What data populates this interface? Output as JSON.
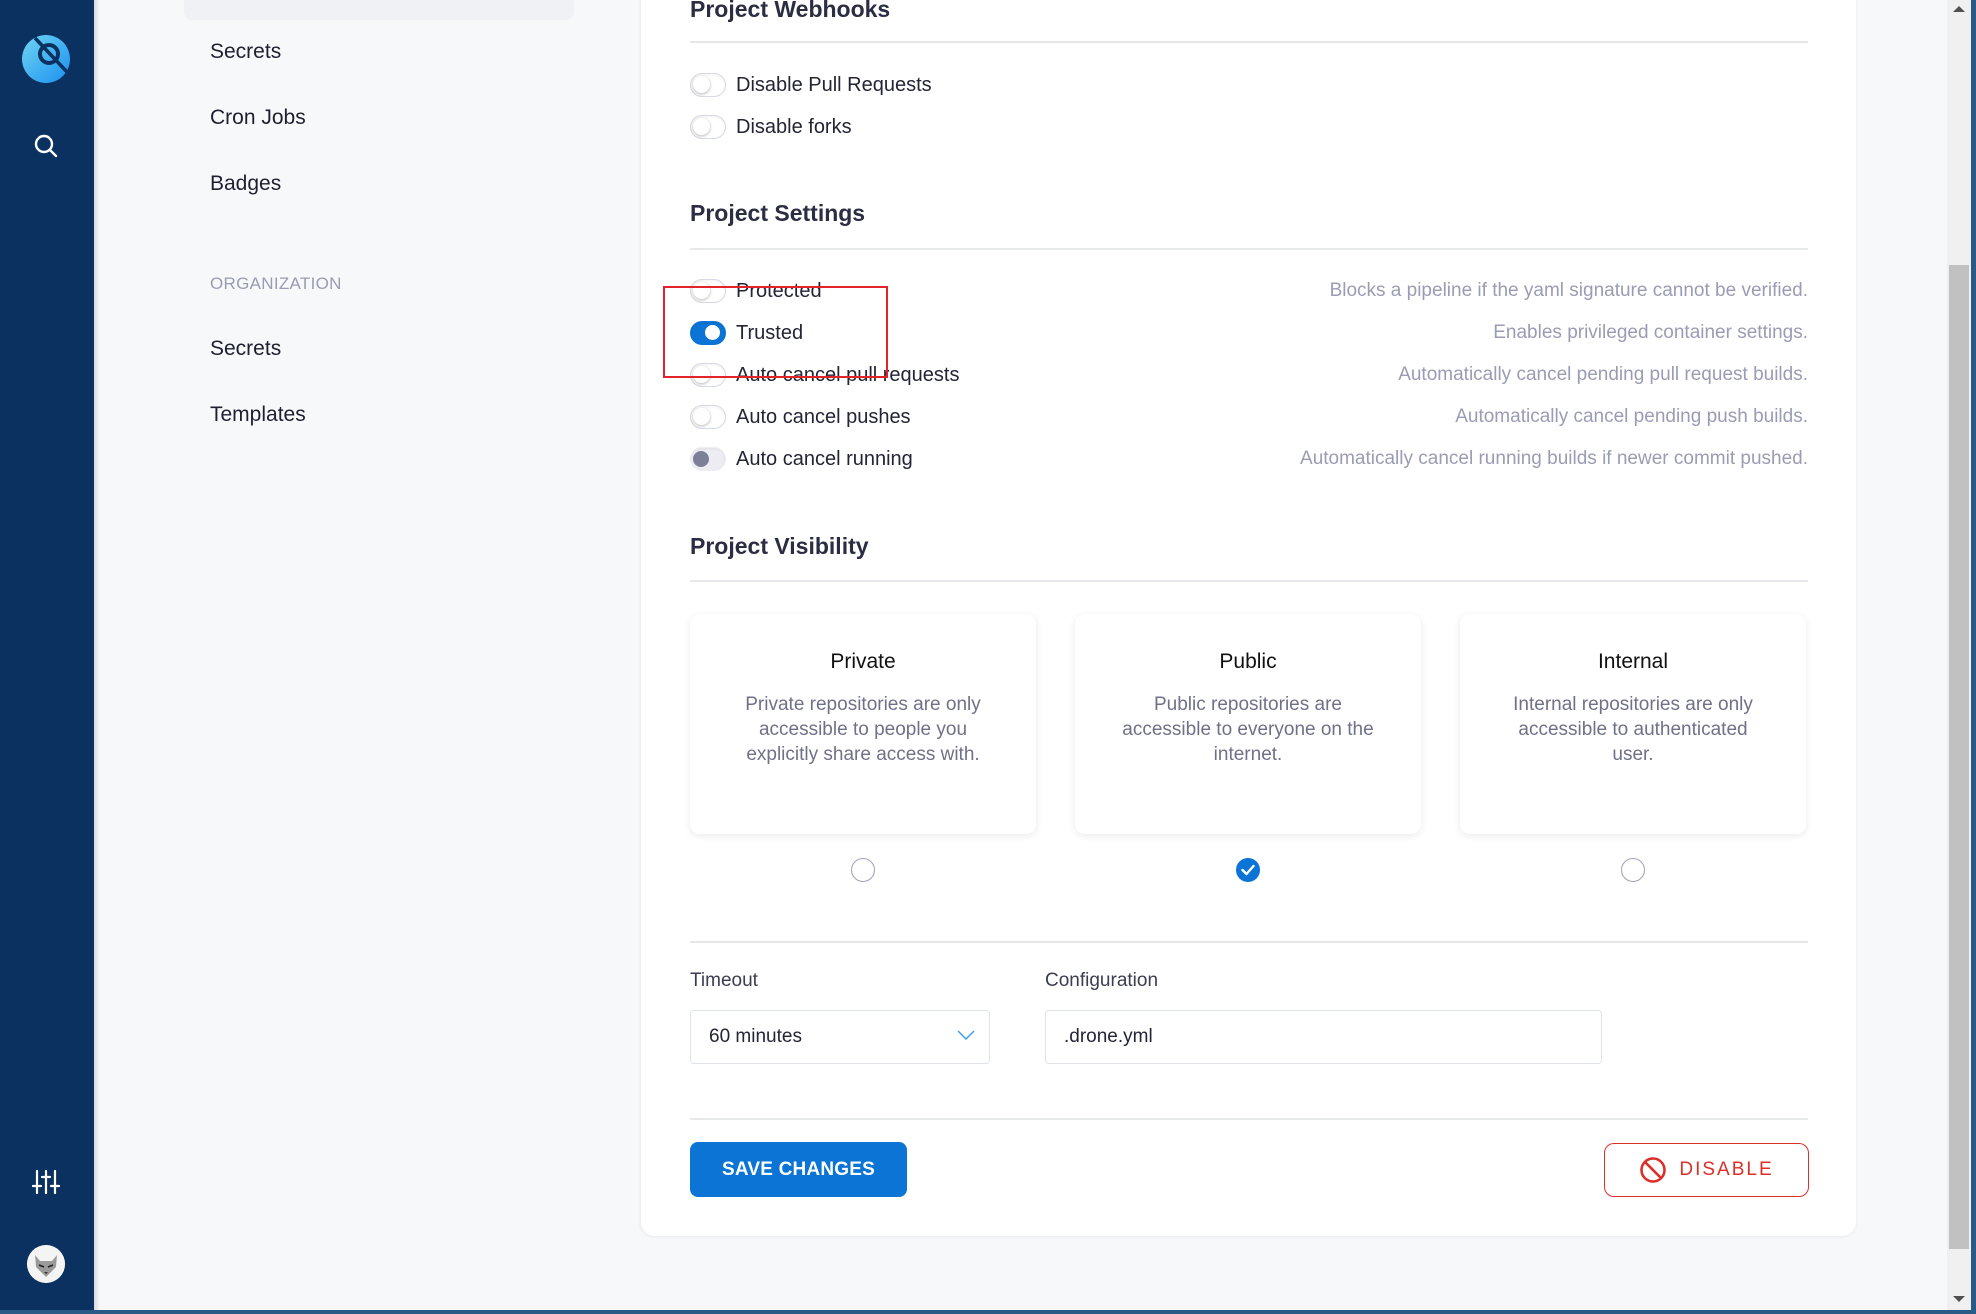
{
  "nav": {
    "logo_icon": "drone-logo-icon",
    "search_icon": "search-icon",
    "settings_icon": "sliders-icon",
    "avatar_icon": "user-avatar"
  },
  "sidebar": {
    "repo_items": [
      {
        "label": "Secrets"
      },
      {
        "label": "Cron Jobs"
      },
      {
        "label": "Badges"
      }
    ],
    "org_section_label": "ORGANIZATION",
    "org_items": [
      {
        "label": "Secrets"
      },
      {
        "label": "Templates"
      }
    ]
  },
  "webhooks": {
    "title": "Project Webhooks",
    "toggles": [
      {
        "label": "Disable Pull Requests",
        "enabled": false
      },
      {
        "label": "Disable forks",
        "enabled": false
      }
    ]
  },
  "settings": {
    "title": "Project Settings",
    "toggles": [
      {
        "label": "Protected",
        "description": "Blocks a pipeline if the yaml signature cannot be verified.",
        "enabled": false
      },
      {
        "label": "Trusted",
        "description": "Enables privileged container settings.",
        "enabled": true
      },
      {
        "label": "Auto cancel pull requests",
        "description": "Automatically cancel pending pull request builds.",
        "enabled": false
      },
      {
        "label": "Auto cancel pushes",
        "description": "Automatically cancel pending push builds.",
        "enabled": false
      },
      {
        "label": "Auto cancel running",
        "description": "Automatically cancel running builds if newer commit pushed.",
        "enabled": false,
        "disabled": true
      }
    ]
  },
  "visibility": {
    "title": "Project Visibility",
    "selected": "Public",
    "options": [
      {
        "title": "Private",
        "description": "Private repositories are only accessible to people you explicitly share access with."
      },
      {
        "title": "Public",
        "description": "Public repositories are accessible to everyone on the internet."
      },
      {
        "title": "Internal",
        "description": "Internal repositories are only accessible to authenticated user."
      }
    ]
  },
  "form": {
    "timeout_label": "Timeout",
    "timeout_value": "60 minutes",
    "config_label": "Configuration",
    "config_value": ".drone.yml"
  },
  "actions": {
    "save_label": "SAVE CHANGES",
    "disable_label": "DISABLE"
  },
  "colors": {
    "primary": "#0b74d4",
    "nav_bg": "#0b3161",
    "danger": "#dc2f2a",
    "highlight_box": "#e3222b"
  }
}
